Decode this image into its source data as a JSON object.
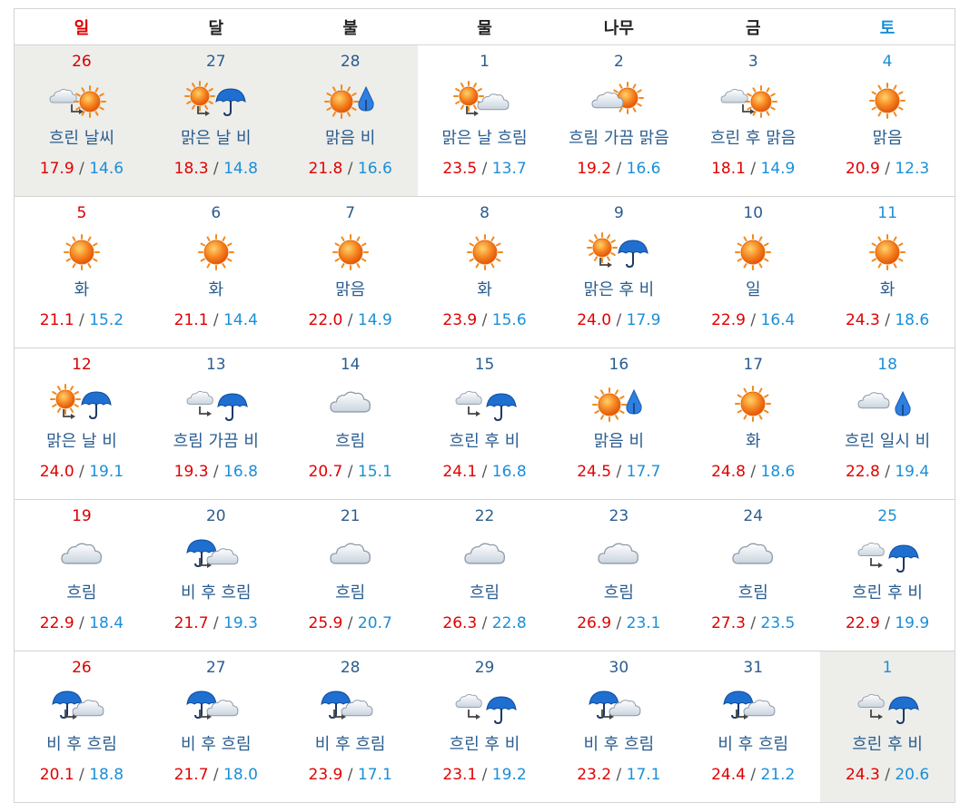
{
  "header": [
    "일",
    "달",
    "불",
    "물",
    "나무",
    "금",
    "토"
  ],
  "weeks": [
    [
      {
        "d": "26",
        "icon": "cloud-sun",
        "cond": "흐린 날씨",
        "max": "17.9",
        "min": "14.6",
        "muted": "prev"
      },
      {
        "d": "27",
        "icon": "sun-rain",
        "cond": "맑은 날 비",
        "max": "18.3",
        "min": "14.8",
        "muted": "prev"
      },
      {
        "d": "28",
        "icon": "sun-drop",
        "cond": "맑음 비",
        "max": "21.8",
        "min": "16.6",
        "muted": "prev"
      },
      {
        "d": "1",
        "icon": "sun-cloud",
        "cond": "맑은 날 흐림",
        "max": "23.5",
        "min": "13.7"
      },
      {
        "d": "2",
        "icon": "partly",
        "cond": "흐림 가끔 맑음",
        "max": "19.2",
        "min": "16.6"
      },
      {
        "d": "3",
        "icon": "cloud-sun",
        "cond": "흐린 후 맑음",
        "max": "18.1",
        "min": "14.9"
      },
      {
        "d": "4",
        "icon": "sun",
        "cond": "맑음",
        "max": "20.9",
        "min": "12.3"
      }
    ],
    [
      {
        "d": "5",
        "icon": "sun",
        "cond": "화",
        "max": "21.1",
        "min": "15.2"
      },
      {
        "d": "6",
        "icon": "sun",
        "cond": "화",
        "max": "21.1",
        "min": "14.4"
      },
      {
        "d": "7",
        "icon": "sun",
        "cond": "맑음",
        "max": "22.0",
        "min": "14.9"
      },
      {
        "d": "8",
        "icon": "sun",
        "cond": "화",
        "max": "23.9",
        "min": "15.6"
      },
      {
        "d": "9",
        "icon": "sun-rain",
        "cond": "맑은 후 비",
        "max": "24.0",
        "min": "17.9"
      },
      {
        "d": "10",
        "icon": "sun",
        "cond": "일",
        "max": "22.9",
        "min": "16.4"
      },
      {
        "d": "11",
        "icon": "sun",
        "cond": "화",
        "max": "24.3",
        "min": "18.6"
      }
    ],
    [
      {
        "d": "12",
        "icon": "sun-rain",
        "cond": "맑은 날 비",
        "max": "24.0",
        "min": "19.1"
      },
      {
        "d": "13",
        "icon": "cloud-rain",
        "cond": "흐림 가끔 비",
        "max": "19.3",
        "min": "16.8"
      },
      {
        "d": "14",
        "icon": "cloud",
        "cond": "흐림",
        "max": "20.7",
        "min": "15.1"
      },
      {
        "d": "15",
        "icon": "cloud-rain",
        "cond": "흐린 후 비",
        "max": "24.1",
        "min": "16.8"
      },
      {
        "d": "16",
        "icon": "sun-drop",
        "cond": "맑음 비",
        "max": "24.5",
        "min": "17.7"
      },
      {
        "d": "17",
        "icon": "sun",
        "cond": "화",
        "max": "24.8",
        "min": "18.6"
      },
      {
        "d": "18",
        "icon": "cloud-drop",
        "cond": "흐린 일시 비",
        "max": "22.8",
        "min": "19.4"
      }
    ],
    [
      {
        "d": "19",
        "icon": "cloud",
        "cond": "흐림",
        "max": "22.9",
        "min": "18.4"
      },
      {
        "d": "20",
        "icon": "rain-cloud",
        "cond": "비 후 흐림",
        "max": "21.7",
        "min": "19.3"
      },
      {
        "d": "21",
        "icon": "cloud",
        "cond": "흐림",
        "max": "25.9",
        "min": "20.7"
      },
      {
        "d": "22",
        "icon": "cloud",
        "cond": "흐림",
        "max": "26.3",
        "min": "22.8"
      },
      {
        "d": "23",
        "icon": "cloud",
        "cond": "흐림",
        "max": "26.9",
        "min": "23.1"
      },
      {
        "d": "24",
        "icon": "cloud",
        "cond": "흐림",
        "max": "27.3",
        "min": "23.5"
      },
      {
        "d": "25",
        "icon": "cloud-rain",
        "cond": "흐린 후 비",
        "max": "22.9",
        "min": "19.9"
      }
    ],
    [
      {
        "d": "26",
        "icon": "rain-cloud",
        "cond": "비 후 흐림",
        "max": "20.1",
        "min": "18.8"
      },
      {
        "d": "27",
        "icon": "rain-cloud",
        "cond": "비 후 흐림",
        "max": "21.7",
        "min": "18.0"
      },
      {
        "d": "28",
        "icon": "rain-cloud",
        "cond": "비 후 흐림",
        "max": "23.9",
        "min": "17.1"
      },
      {
        "d": "29",
        "icon": "cloud-rain",
        "cond": "흐린 후 비",
        "max": "23.1",
        "min": "19.2"
      },
      {
        "d": "30",
        "icon": "rain-cloud",
        "cond": "비 후 흐림",
        "max": "23.2",
        "min": "17.1"
      },
      {
        "d": "31",
        "icon": "rain-cloud",
        "cond": "비 후 흐림",
        "max": "24.4",
        "min": "21.2"
      },
      {
        "d": "1",
        "icon": "cloud-rain",
        "cond": "흐린 후 비",
        "max": "24.3",
        "min": "20.6",
        "muted": "next"
      }
    ]
  ],
  "colors": {
    "sunday": "#d40000",
    "saturday": "#1a8fd8",
    "max_temp": "#e00000",
    "min_temp": "#1a8fd8",
    "date": "#2a5d8f"
  }
}
